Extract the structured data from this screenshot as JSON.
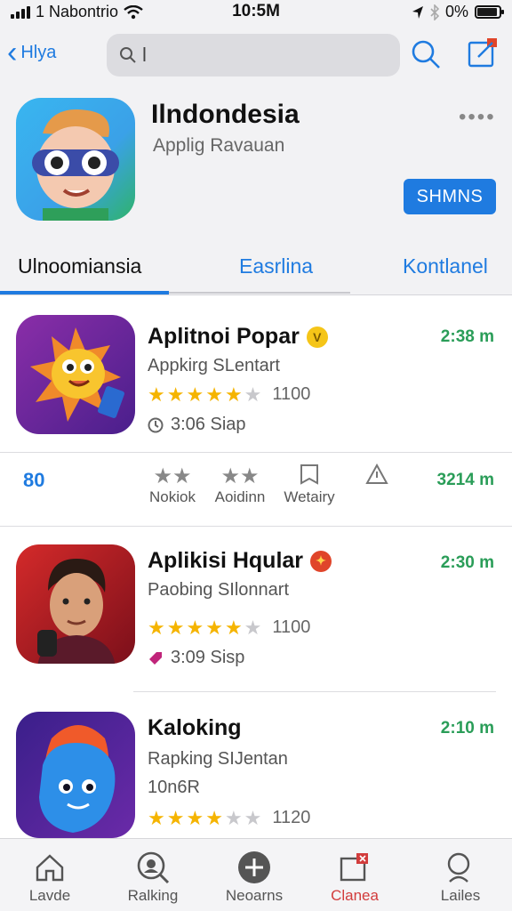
{
  "status_bar": {
    "carrier": "1 Nabontrio",
    "time": "10:5M",
    "battery": "0%"
  },
  "nav": {
    "back_label": "Hlya",
    "search_value": "l",
    "search_placeholder": ""
  },
  "hero": {
    "title": "Ilndondesia",
    "subtitle": "Applig Ravauan",
    "more": "••••",
    "get_label": "SHMNS"
  },
  "tabs": [
    {
      "label": "Ulnoomiansia"
    },
    {
      "label": "Easrlina"
    },
    {
      "label": "Kontlanel"
    }
  ],
  "apps": [
    {
      "title": "Aplitnoi Popar",
      "badge": "V",
      "badge_color": "#f5c518",
      "subtitle": "Appkirg SLentart",
      "stars_filled": 4.5,
      "rating_count": "1100",
      "meta": "3:06 Siap",
      "time": "2:38 m"
    },
    {
      "title": "Aplikisi Hqular",
      "badge": "✦",
      "badge_color": "#e0452a",
      "subtitle": "Paobing SIlonnart",
      "stars_filled": 4,
      "rating_count": "1100",
      "meta": "3:09 Sisp",
      "time": "2:30 m"
    },
    {
      "title": "Kaloking",
      "subtitle": "Rapking SIJentan",
      "extra": "10n6R",
      "stars_filled": 3.5,
      "rating_count": "1120",
      "time": "2:10 m"
    }
  ],
  "actions": {
    "count": "80",
    "items": [
      {
        "label": "Nokiok",
        "icon": "stars-icon"
      },
      {
        "label": "Aoidinn",
        "icon": "stars-icon"
      },
      {
        "label": "Wetairy",
        "icon": "bookmark-icon"
      },
      {
        "label": "",
        "icon": "warning-icon"
      }
    ],
    "time": "3214 m"
  },
  "tabbar": [
    {
      "label": "Lavde",
      "icon": "home-icon"
    },
    {
      "label": "Ralking",
      "icon": "chat-search-icon"
    },
    {
      "label": "Neoarns",
      "icon": "add-circle-icon"
    },
    {
      "label": "Clanea",
      "icon": "notification-icon",
      "active": true
    },
    {
      "label": "Lailes",
      "icon": "search-icon"
    }
  ],
  "colors": {
    "accent": "#1f7be0",
    "time_green": "#2a9d58",
    "star": "#f5b400",
    "active_tab": "#d23c3c"
  }
}
